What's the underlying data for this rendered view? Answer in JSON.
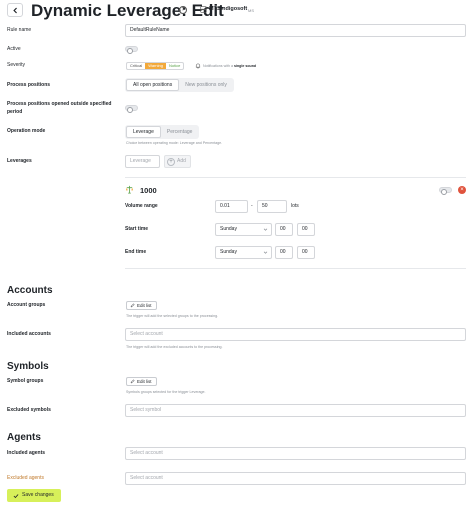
{
  "header": {
    "title": "Dynamic Leverage: Edit",
    "help": "?",
    "server_name": "MTSIndigosoft",
    "server_tag": "MS"
  },
  "form": {
    "rule_name": {
      "label": "Rule name",
      "value": "DefaultRuleName"
    },
    "active": {
      "label": "Active",
      "on": false
    },
    "severity": {
      "label": "Severity",
      "options": [
        "Critical",
        "Warning",
        "Notice"
      ],
      "selected": "Warning",
      "notify_prefix": "Notifications with a",
      "notify_bold": "single sound"
    },
    "process_positions": {
      "label": "Process positions",
      "options": [
        "All open positions",
        "New positions only"
      ],
      "selected": "All open positions"
    },
    "process_outside": {
      "label_line1": "Process positions opened outside specified",
      "label_line2": "period",
      "on": false
    },
    "operation_mode": {
      "label": "Operation mode",
      "options": [
        "Leverage",
        "Percentage"
      ],
      "selected": "Leverage",
      "hint": "Choice between operating mode: Leverage and Percentage."
    },
    "leverages": {
      "label": "Leverages",
      "placeholder": "Leverage",
      "add_label": "Add"
    },
    "leverage_item": {
      "value": "1000",
      "on": false,
      "remove": "×",
      "volume_range_label": "Volume range",
      "volume_min": "0.01",
      "volume_sep": "-",
      "volume_max": "50",
      "volume_unit": "lots",
      "start_time_label": "Start time",
      "start_day": "Sunday",
      "start_hour": "00",
      "start_minute": "00",
      "end_time_label": "End time",
      "end_day": "Sunday",
      "end_hour": "00",
      "end_minute": "00"
    }
  },
  "accounts": {
    "title": "Accounts",
    "groups_label": "Account groups",
    "edit_list": "Edit list",
    "groups_hint": "The trigger will add the selected groups to the processing.",
    "included_label": "Included accounts",
    "included_placeholder": "Select account",
    "included_hint": "The trigger will add the excluded accounts to the processing."
  },
  "symbols": {
    "title": "Symbols",
    "groups_label": "Symbol groups",
    "edit_list": "Edit list",
    "groups_hint": "Symbols groups selected for the trigger Leverage.",
    "excluded_label": "Excluded symbols",
    "excluded_placeholder": "Select symbol"
  },
  "agents": {
    "title": "Agents",
    "included_label": "Included agents",
    "included_placeholder": "Select account",
    "excluded_label": "Excluded agents",
    "excluded_placeholder": "Select account"
  },
  "footer": {
    "save_label": "Save changes"
  },
  "colors": {
    "accent": "#d7f05a",
    "warning": "#f2a93b",
    "notice": "#5aa24a",
    "danger": "#e0533d",
    "excluded_label": "#c0792a"
  }
}
